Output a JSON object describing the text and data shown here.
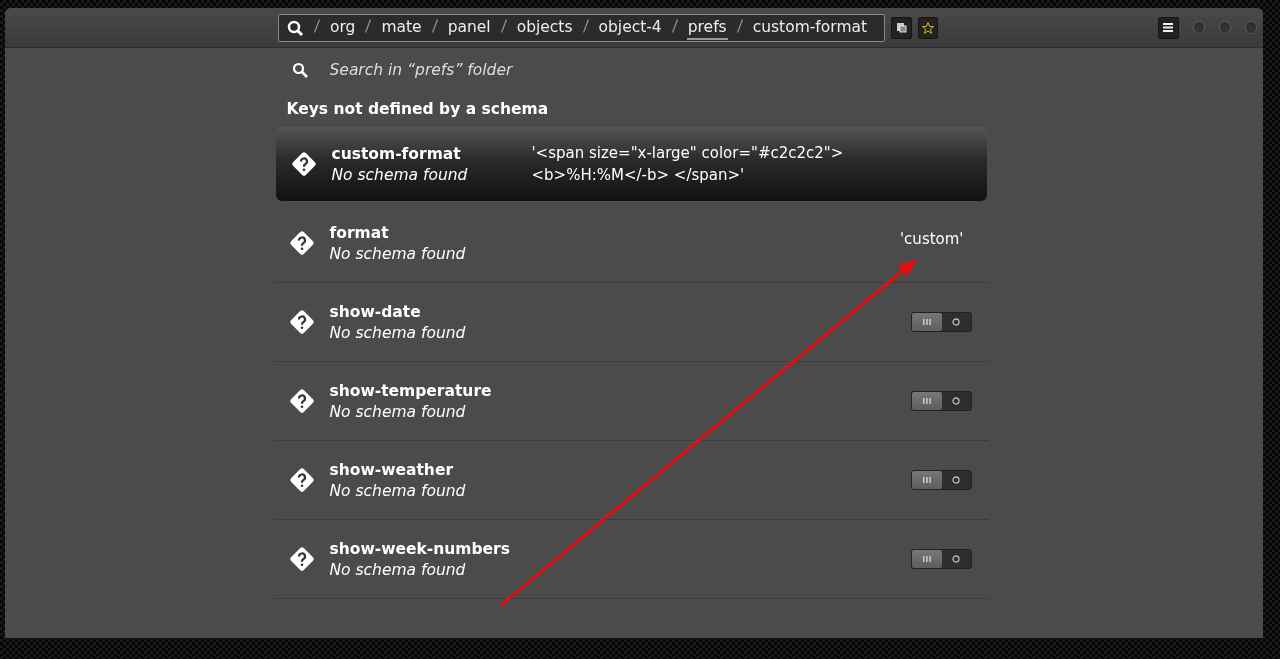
{
  "path_bar": {
    "segments": [
      {
        "label": "org",
        "selected": false
      },
      {
        "label": "mate",
        "selected": false
      },
      {
        "label": "panel",
        "selected": false
      },
      {
        "label": "objects",
        "selected": false
      },
      {
        "label": "object-4",
        "selected": false
      },
      {
        "label": "prefs",
        "selected": true
      },
      {
        "label": "custom-format",
        "selected": false
      }
    ]
  },
  "search": {
    "placeholder": "Search in “prefs” folder"
  },
  "section_title": "Keys not defined by a schema",
  "keys": [
    {
      "kind": "text",
      "name": "custom-format",
      "summary": "No schema found",
      "value": "'<span size=\"x-large\" color=\"#c2c2c2\">  <b>%H:%M</-b> </span>'",
      "selected": true
    },
    {
      "kind": "text",
      "name": "format",
      "summary": "No schema found",
      "value": "'custom'",
      "selected": false
    },
    {
      "kind": "switch",
      "name": "show-date",
      "summary": "No schema found",
      "on": false,
      "selected": false
    },
    {
      "kind": "switch",
      "name": "show-temperature",
      "summary": "No schema found",
      "on": false,
      "selected": false
    },
    {
      "kind": "switch",
      "name": "show-weather",
      "summary": "No schema found",
      "on": false,
      "selected": false
    },
    {
      "kind": "switch",
      "name": "show-week-numbers",
      "summary": "No schema found",
      "on": false,
      "selected": false
    }
  ]
}
